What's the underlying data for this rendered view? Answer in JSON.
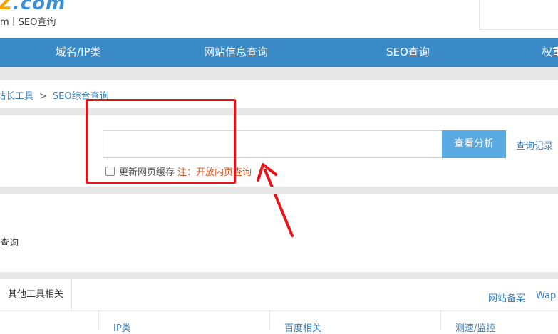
{
  "logo": {
    "brand_prefix": "Z",
    "brand_suffix": ".com",
    "subtitle": "m丨SEO查询"
  },
  "nav": {
    "items": [
      "域名/IP类",
      "网站信息查询",
      "SEO查询",
      "权重"
    ]
  },
  "breadcrumb": {
    "parent": "站长工具",
    "separator": ">",
    "current": "SEO综合查询"
  },
  "search": {
    "value": "",
    "button_label": "查看分析",
    "history_label": "查询记录"
  },
  "cache": {
    "label": "更新网页缓存",
    "note": "注：开放内页查询"
  },
  "section": {
    "label": "查询"
  },
  "tabs": {
    "other": "其他工具相关",
    "right_links": [
      "网站备案",
      "Wap"
    ]
  },
  "columns": [
    "IP类",
    "百度相关",
    "测速/监控"
  ],
  "colors": {
    "nav_bg": "#3a8ac8",
    "button_bg": "#5aaae4",
    "annotation": "#e8141a",
    "link": "#3a7fb8",
    "note": "#d2541c"
  }
}
